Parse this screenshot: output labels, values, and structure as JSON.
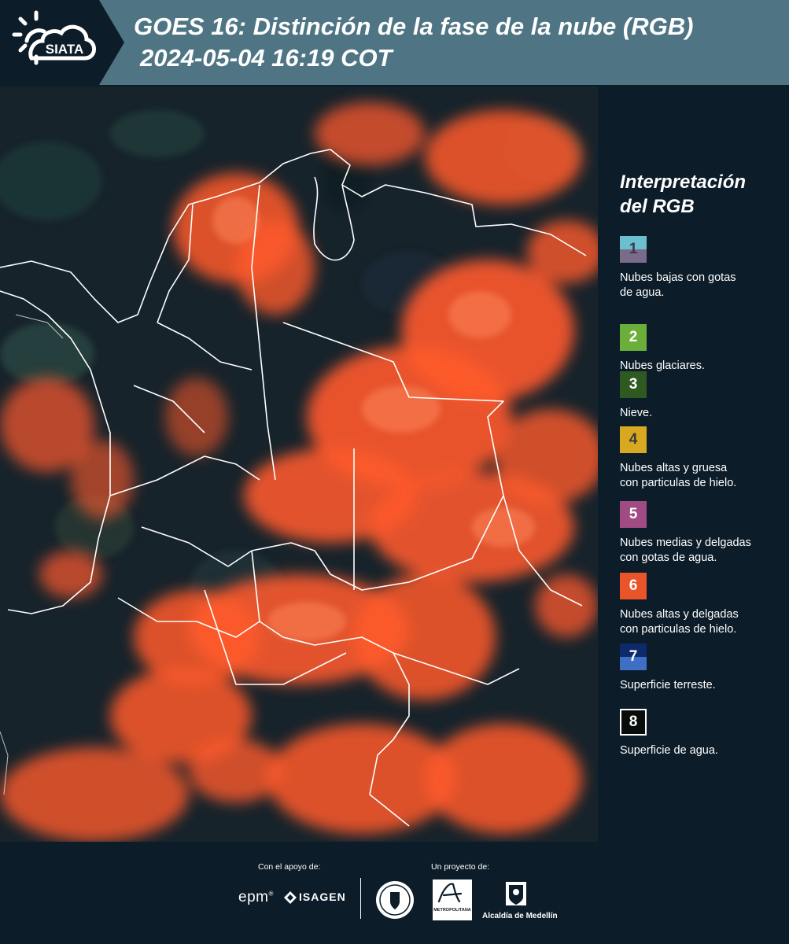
{
  "header": {
    "logo_text": "SIATA",
    "title_line1": "GOES 16: Distinción de la fase de la nube (RGB)",
    "title_line2": "2024-05-04 16:19 COT"
  },
  "map": {
    "icon": "satellite-map-image",
    "colors": {
      "cloud": "#ff5a2c",
      "ground": "#17232b",
      "border": "#ffffff"
    }
  },
  "legend": {
    "title_line1": "Interpretación",
    "title_line2": "del RGB",
    "items": [
      {
        "number": "1",
        "label_line1": "Nubes bajas con gotas",
        "label_line2": "de agua.",
        "color_top": "#6bbfcf",
        "color_bottom": "#7b6b8a",
        "text_color": "#3a3a4a"
      },
      {
        "number": "2",
        "label_line1": "Nubes glaciares.",
        "label_line2": "",
        "color_top": "#6bae3a",
        "color_bottom": "#6bae3a",
        "text_color": "#ffffff"
      },
      {
        "number": "3",
        "label_line1": "Nieve.",
        "label_line2": "",
        "color_top": "#2e5a22",
        "color_bottom": "#2e5a22",
        "text_color": "#ffffff"
      },
      {
        "number": "4",
        "label_line1": "Nubes altas y gruesa",
        "label_line2": "con particulas de hielo.",
        "color_top": "#d9a821",
        "color_bottom": "#d9a821",
        "text_color": "#3a3a3a"
      },
      {
        "number": "5",
        "label_line1": "Nubes medias y delgadas",
        "label_line2": "con gotas de agua.",
        "color_top": "#a04b83",
        "color_bottom": "#a04b83",
        "text_color": "#ffffff"
      },
      {
        "number": "6",
        "label_line1": "Nubes altas y delgadas",
        "label_line2": "con particulas de hielo.",
        "color_top": "#e9542b",
        "color_bottom": "#e9542b",
        "text_color": "#ffffff"
      },
      {
        "number": "7",
        "label_line1": "Superficie terreste.",
        "label_line2": "",
        "color_top": "#0e2a6a",
        "color_bottom": "#3f6fc4",
        "text_color": "#ffffff"
      },
      {
        "number": "8",
        "label_line1": "Superficie de agua.",
        "label_line2": "",
        "color_top": "#080c0a",
        "color_bottom": "#080c0a",
        "text_color": "#ffffff"
      }
    ]
  },
  "footer": {
    "support_caption": "Con el apoyo de:",
    "project_caption": "Un proyecto de:",
    "sponsor_epm": "epm",
    "sponsor_isagen": "ISAGEN",
    "sponsor_metropolitana": "METROPOLITANA",
    "sponsor_alcaldia": "Alcaldía de Medellín"
  }
}
